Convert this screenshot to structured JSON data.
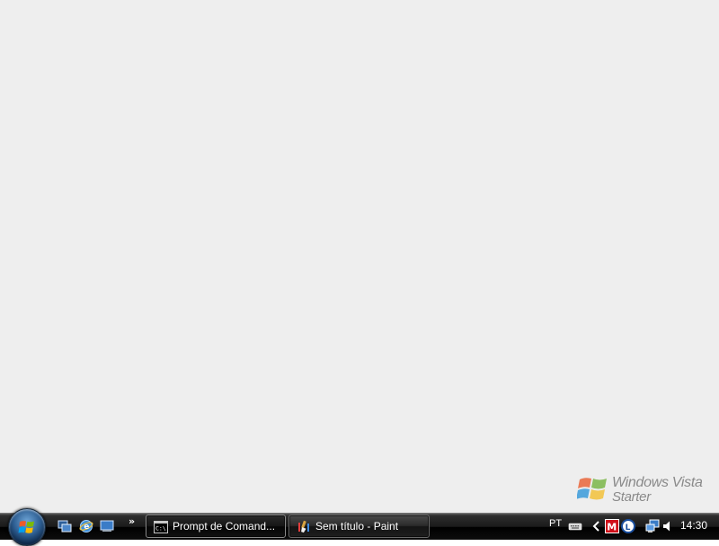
{
  "watermark": {
    "line1": "Windows Vista",
    "line2": "Starter"
  },
  "taskbar": {
    "start_button_icon": "windows-orb-icon",
    "quick_launch": [
      {
        "icon": "switch-windows-icon"
      },
      {
        "icon": "internet-explorer-icon"
      },
      {
        "icon": "show-desktop-icon"
      }
    ],
    "quick_launch_more": "»",
    "tasks": [
      {
        "label": "Prompt de Comand...",
        "icon": "command-prompt-icon",
        "active": true
      },
      {
        "label": "Sem título - Paint",
        "icon": "paint-icon",
        "active": false
      }
    ]
  },
  "tray": {
    "language": "PT",
    "icons": [
      "keyboard-icon",
      "show-hidden-icons-chevron",
      "mcafee-icon",
      "update-icon",
      "network-icon",
      "volume-icon"
    ],
    "clock": "14:30"
  },
  "colors": {
    "desktop_background": "#eeeeee",
    "taskbar_background": "#111111",
    "taskbar_text": "#ffffff",
    "watermark_text": "#8a8a8a",
    "mcafee_red": "#d0101a",
    "orb_blue": "#2e5f93"
  }
}
